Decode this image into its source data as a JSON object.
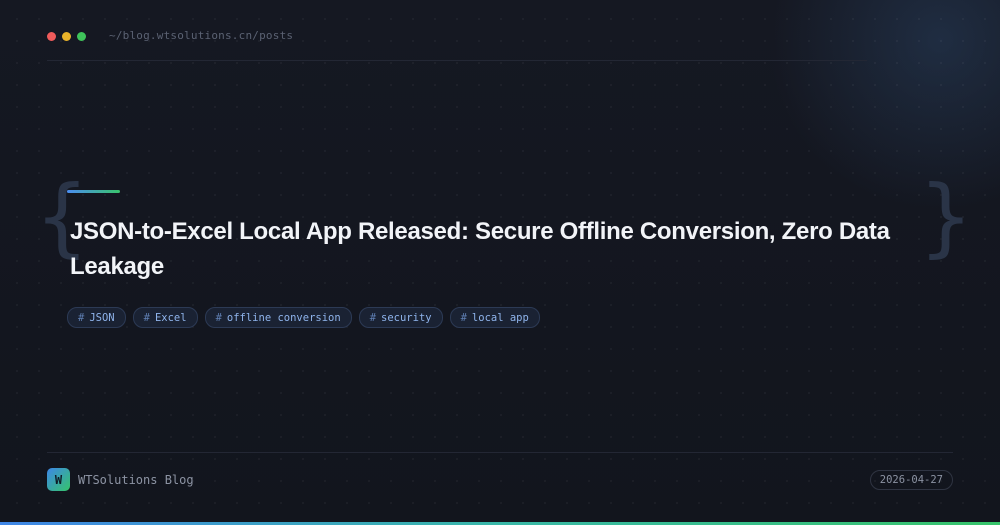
{
  "window": {
    "controls": [
      "red",
      "yellow",
      "green"
    ],
    "path": "~/blog.wtsolutions.cn/posts"
  },
  "hero": {
    "brace_open": "{",
    "brace_close": "}",
    "title": "JSON-to-Excel Local App Released: Secure Offline Conversion, Zero Data Leakage"
  },
  "tags": [
    {
      "hash": "#",
      "label": "JSON"
    },
    {
      "hash": "#",
      "label": "Excel"
    },
    {
      "hash": "#",
      "label": "offline conversion"
    },
    {
      "hash": "#",
      "label": "security"
    },
    {
      "hash": "#",
      "label": "local app"
    }
  ],
  "footer": {
    "logo_letter": "W",
    "brand": "WTSolutions Blog",
    "date": "2026-04-27"
  },
  "colors": {
    "background": "#13161f",
    "accent_blue": "#3f86e6",
    "accent_green": "#37c46a",
    "tag_text": "#8fb4ec",
    "title_text": "#f2f4f8"
  }
}
